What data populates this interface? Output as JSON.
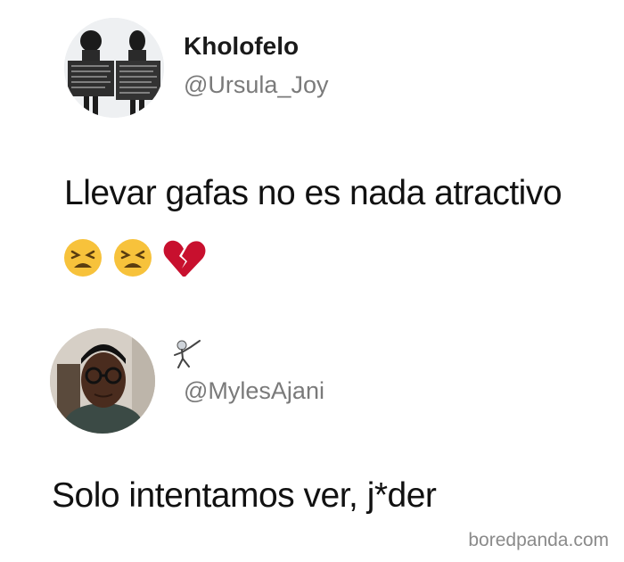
{
  "tweet1": {
    "display_name": "Kholofelo",
    "handle": "@Ursula_Joy",
    "text": "Llevar gafas no es nada atractivo",
    "emojis": [
      "tired-face-emoji",
      "tired-face-emoji",
      "broken-heart-emoji"
    ]
  },
  "tweet2": {
    "display_name_icon": "fencer-emoji",
    "handle": "@MylesAjani",
    "text": "Solo intentamos ver, j*der"
  },
  "watermark": "boredpanda.com"
}
